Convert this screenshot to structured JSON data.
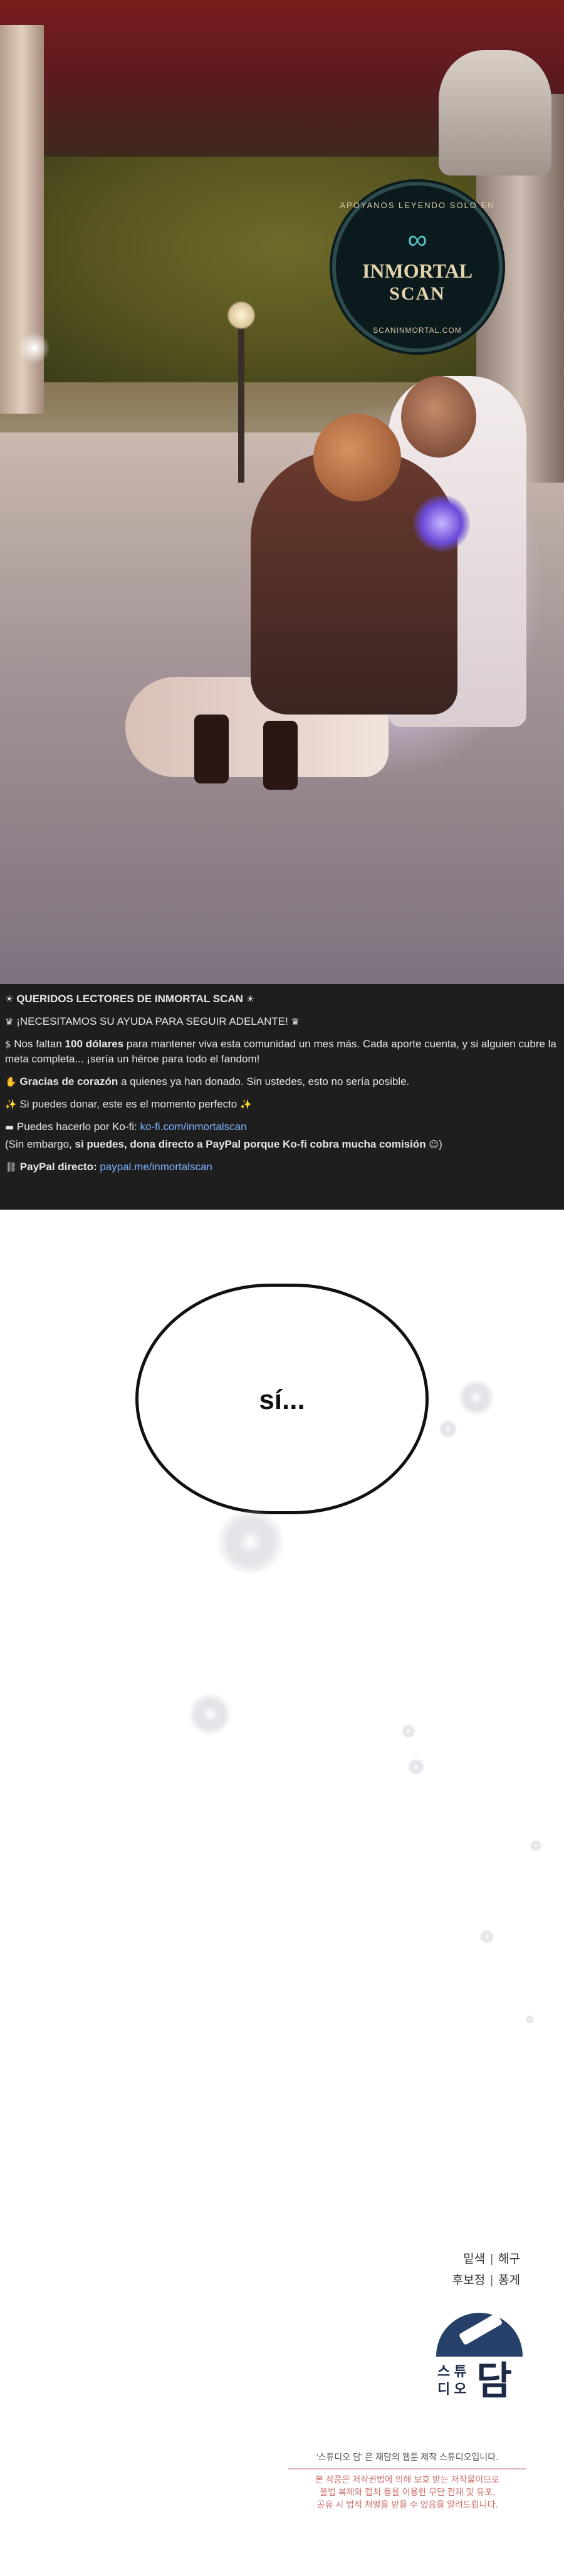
{
  "badge": {
    "ring_top": "APOYANOS LEYENDO SOLO EN",
    "brand_line1": "INMORTAL",
    "brand_line2": "SCAN",
    "ring_bottom": "SCANINMORTAL.COM"
  },
  "notice": {
    "heading": "QUERIDOS LECTORES DE INMORTAL SCAN",
    "line2": "¡NECESITAMOS SU AYUDA PARA SEGUIR ADELANTE!",
    "line3_pre": "Nos faltan ",
    "line3_bold": "100 dólares",
    "line3_post": " para mantener viva esta comunidad un mes más. Cada aporte cuenta, y si alguien cubre la meta completa... ¡sería un héroe para todo el fandom!",
    "line4_bold": "Gracias de corazón",
    "line4_post": " a quienes ya han donado. Sin ustedes, esto no sería posible.",
    "line5": "Si puedes donar, este es el momento perfecto",
    "line6_pre": "Puedes hacerlo por Ko-fi: ",
    "line6_link": "ko-fi.com/inmortalscan",
    "line7_pre": "(Sin embargo, ",
    "line7_bold": "si puedes, dona directo a PayPal porque Ko-fi cobra mucha comisión",
    "line7_post": ")",
    "line8_bold": "PayPal directo:",
    "line8_link": "paypal.me/inmortalscan"
  },
  "bubble": {
    "text": "sí..."
  },
  "credits": {
    "row1_a": "밑색",
    "row1_b": "해구",
    "row2_a": "후보정",
    "row2_b": "퐁게"
  },
  "logo": {
    "small_text": "스튜\n디오",
    "big_text": "담"
  },
  "footer": {
    "line1": "'스튜디오 담' 은 재담의 웹툰 제작 스튜디오입니다.",
    "warn1": "본 작품은 저작권법에 의해 보호 받는 저작물이므로",
    "warn2": "불법 복제와 캡처 등을 이용한 무단 전재 및 유포,",
    "warn3": "공유 시 법적 처벌을 받을 수 있음을 알려드립니다."
  },
  "colors": {
    "notice_bg": "#1e1e1e",
    "link": "#7fb2ff",
    "logo_blue": "#27406a",
    "warning": "#d07070"
  }
}
